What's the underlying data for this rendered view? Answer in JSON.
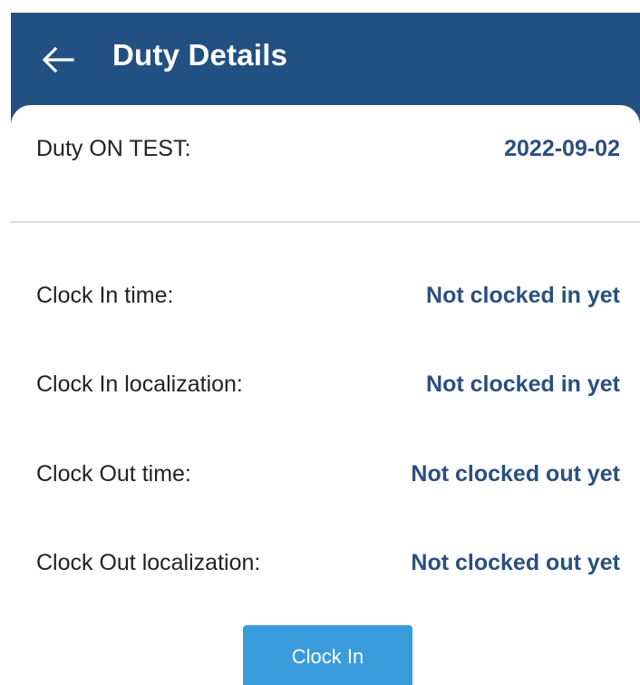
{
  "app_bar": {
    "title": "Duty Details",
    "back_icon": "arrow-left-icon",
    "background_color": "#235083"
  },
  "duty": {
    "label": "Duty ON TEST:",
    "date": "2022-09-02"
  },
  "details": [
    {
      "label": "Clock In time:",
      "value": "Not clocked in yet"
    },
    {
      "label": "Clock In localization:",
      "value": "Not clocked in yet"
    },
    {
      "label": "Clock Out time:",
      "value": "Not clocked out yet"
    },
    {
      "label": "Clock Out localization:",
      "value": "Not clocked out yet"
    }
  ],
  "actions": {
    "clock_in_label": "Clock In",
    "clock_in_color": "#3a9bdc"
  },
  "colors": {
    "value_text": "#2a4f80",
    "label_text": "#222222"
  }
}
